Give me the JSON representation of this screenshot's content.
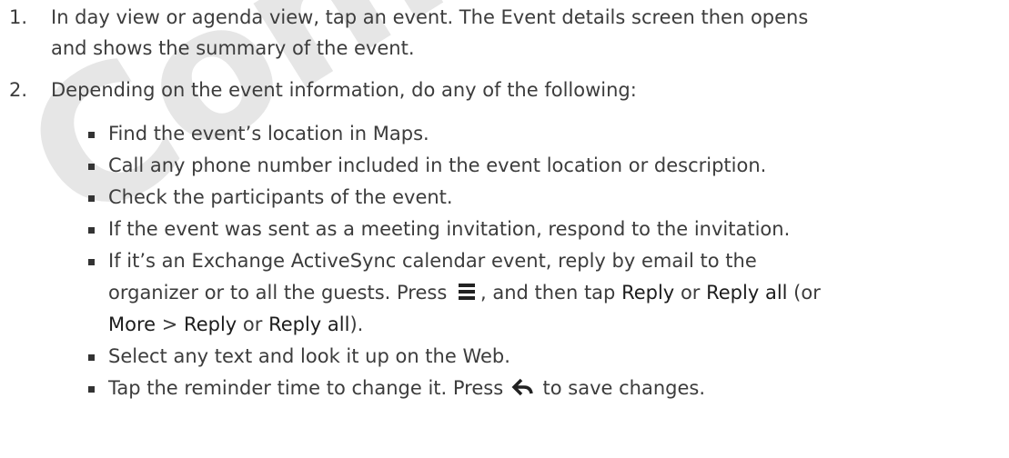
{
  "watermark": "Confidential",
  "steps": [
    {
      "num": "1.",
      "line1": "In day view or agenda view, tap an event. The Event details screen then opens",
      "line2": "and shows the summary of the event."
    },
    {
      "num": "2.",
      "line1": "Depending on the event information, do any of the following:"
    }
  ],
  "bullets": {
    "b1": "Find the event’s location in Maps.",
    "b2": "Call any phone number included in the event location or description.",
    "b3": "Check the participants of the event.",
    "b4": "If the event was sent as a meeting invitation, respond to the invitation.",
    "b5_line1": "If it’s an Exchange ActiveSync calendar event, reply by email to the",
    "b5_line2_a": "organizer or to all the guests. Press",
    "b5_line2_b": ", and then tap",
    "b5_reply": "Reply",
    "b5_or": "or",
    "b5_reply_all": "Reply all",
    "b5_paren_open": "(or",
    "b5_more": "More",
    "b5_gt": ">",
    "b5_reply2": "Reply",
    "b5_or2": "or",
    "b5_reply_all2": "Reply all",
    "b5_end": ").",
    "b6": "Select any text and look it up on the Web.",
    "b7_a": "Tap the reminder time to change it. Press",
    "b7_b": "to save changes."
  },
  "icons": {
    "menu": "menu-icon",
    "back": "back-arrow-icon"
  }
}
